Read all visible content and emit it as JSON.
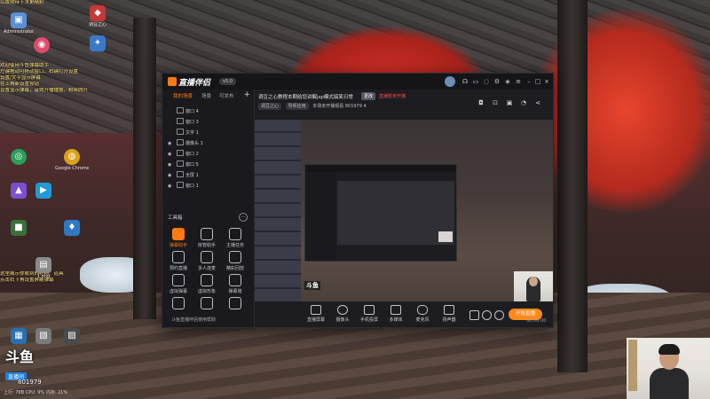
{
  "desktop": {
    "chat_lines": [
      "以致期待下水更精彩",
      "",
      "",
      "",
      "",
      "",
      "",
      "",
      "欢迎使用斗鱼弹幕助手",
      "左键拖动可移动窗口，右键打开设置",
      "设置/文字显示屏幕",
      "在上角新设置按钮",
      "设置显示弹幕，音效开播播报，粉丝牌升级",
      "",
      "",
      "",
      "",
      "",
      "",
      "",
      "",
      "",
      "",
      "",
      "",
      "",
      "",
      "",
      "",
      "",
      "",
      "",
      "",
      "",
      "",
      "",
      "",
      "",
      "",
      "这里展示你收到的礼物、道具",
      "点击右下角设置屏蔽弹幕"
    ],
    "icons": [
      {
        "label": "Administrator",
        "color": "#5a8fd6",
        "glyph": "▣"
      },
      {
        "label": "",
        "color": "#e04a6a",
        "glyph": "◉"
      },
      {
        "label": "调豆之心",
        "color": "#c43838",
        "glyph": "◆"
      },
      {
        "label": "",
        "color": "#3a78c8",
        "glyph": "✦"
      },
      {
        "label": "",
        "color": "#2c9e5b",
        "glyph": "◎"
      },
      {
        "label": "Google Chrome",
        "color": "#d9a21b",
        "glyph": "◍"
      },
      {
        "label": "",
        "color": "#7a4fd1",
        "glyph": "▲"
      },
      {
        "label": "",
        "color": "#1f9ad6",
        "glyph": "▶"
      },
      {
        "label": "",
        "color": "#3b6f3b",
        "glyph": "■"
      },
      {
        "label": "",
        "color": "#2f79c4",
        "glyph": "♦"
      },
      {
        "label": "1.png",
        "color": "#8a8a8a",
        "glyph": "▤"
      },
      {
        "label": "",
        "color": "#5d5d5d",
        "glyph": "▥"
      },
      {
        "label": "",
        "color": "#2a6fb0",
        "glyph": "▦"
      },
      {
        "label": "",
        "color": "#7a7a7a",
        "glyph": "▧"
      },
      {
        "label": "",
        "color": "#4a4a4a",
        "glyph": "▨"
      }
    ]
  },
  "app": {
    "brand": "直播伴侣",
    "version": "v5.0",
    "titlebar_icons": [
      "headset-icon",
      "message-icon",
      "bell-icon",
      "settings-icon",
      "skin-icon",
      "menu-icon",
      "minimize-icon",
      "maximize-icon",
      "close-icon"
    ],
    "scene_tabs": [
      "我的场景",
      "场景",
      "可发布"
    ],
    "sources": [
      {
        "label": "窗口 4"
      },
      {
        "label": "窗口 3"
      },
      {
        "label": "文字 1"
      },
      {
        "label": "摄像头 1"
      },
      {
        "label": "窗口 2"
      },
      {
        "label": "窗口 5"
      },
      {
        "label": "全屏 1"
      },
      {
        "label": "窗口 1"
      }
    ],
    "tools_title": "工具箱",
    "tools_more": "…",
    "tools": [
      {
        "label": "弹幕助手",
        "hot": true
      },
      {
        "label": "房管助手",
        "hot": false
      },
      {
        "label": "主播任务",
        "hot": false
      },
      {
        "label": "预约直播",
        "hot": false
      },
      {
        "label": "多人连麦",
        "hot": false
      },
      {
        "label": "精彩回放",
        "hot": false
      },
      {
        "label": "虚拟弹幕",
        "hot": false
      },
      {
        "label": "虚拟形象",
        "hot": false
      },
      {
        "label": "弹幕墙",
        "hot": false
      },
      {
        "label": "",
        "hot": false
      },
      {
        "label": "",
        "hot": false
      },
      {
        "label": "",
        "hot": false
      }
    ],
    "footer_link": "斗鱼直播伴侣使用帮助",
    "room": {
      "title": "调豆之心教程本期给您讲解jsp模式搞笑日常",
      "badge": "更改",
      "warning": "直播暂未开播",
      "category": "调豆之心",
      "type": "导师应用",
      "meta_text": "本场未开播观看",
      "room_id": "801979",
      "followers": "4"
    },
    "top_right_icons": [
      "gift-icon",
      "lock-icon",
      "save-icon",
      "bell-icon",
      "share-icon"
    ],
    "preview": {
      "watermark": "斗鱼"
    },
    "bottom_toolbar": [
      {
        "label": "直播屏幕"
      },
      {
        "label": "摄像头"
      },
      {
        "label": "手机投屏"
      },
      {
        "label": "多媒体"
      },
      {
        "label": "麦克风"
      },
      {
        "label": "扬声器"
      }
    ],
    "start_live": "开始直播",
    "status_time": "00:00:00"
  },
  "overlay": {
    "douyu_logo": "斗鱼",
    "douyu_sub": "直播间",
    "room_number": "801979",
    "taskbar_text": "上行: 7KB  CPU: 9%  内存: 21%"
  }
}
